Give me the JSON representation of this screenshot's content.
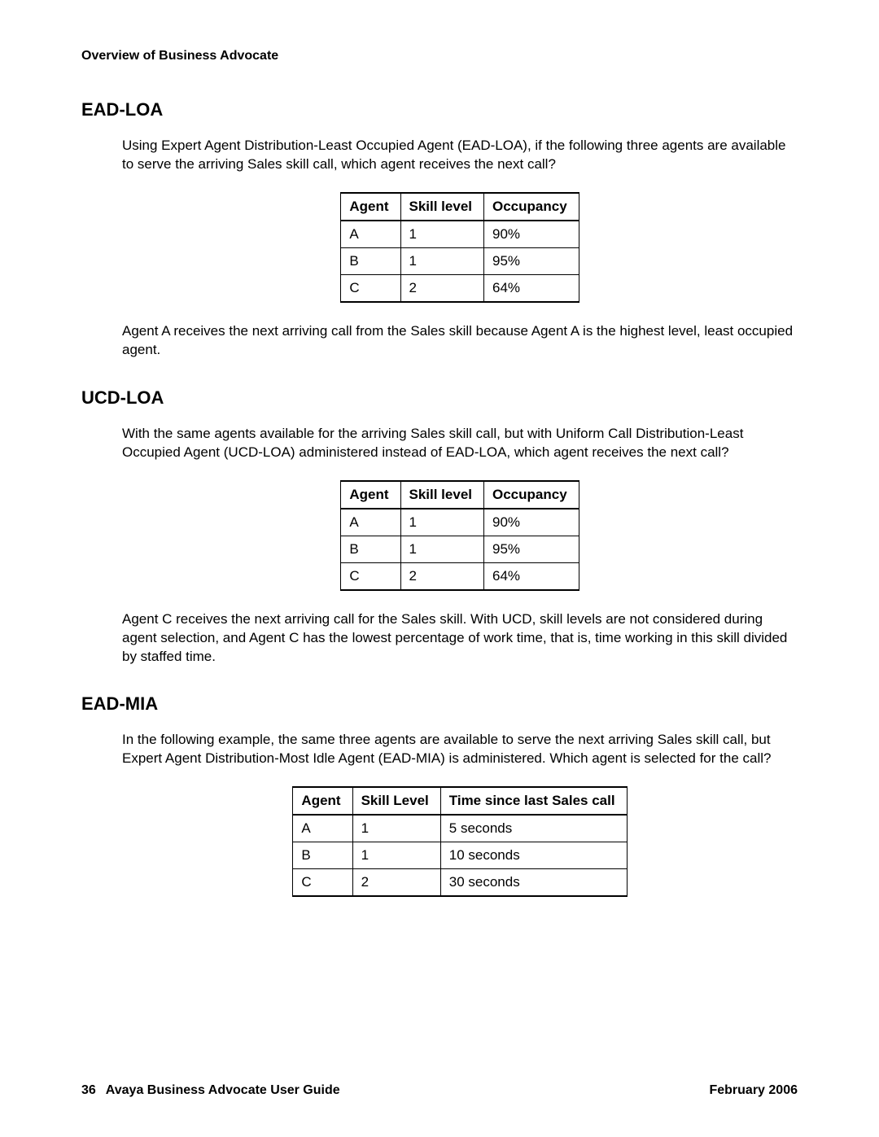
{
  "header": {
    "running_title": "Overview of Business Advocate"
  },
  "sections": [
    {
      "id": "ead-loa",
      "title": "EAD-LOA",
      "intro": "Using Expert Agent Distribution-Least Occupied Agent (EAD-LOA), if the following three agents are available to serve the arriving Sales skill call, which agent receives the next call?",
      "table": {
        "headers": [
          "Agent",
          "Skill level",
          "Occupancy"
        ],
        "rows": [
          [
            "A",
            "1",
            "90%"
          ],
          [
            "B",
            "1",
            "95%"
          ],
          [
            "C",
            "2",
            "64%"
          ]
        ]
      },
      "conclusion": "Agent A receives the next arriving call from the Sales skill because Agent A is the highest level, least occupied agent."
    },
    {
      "id": "ucd-loa",
      "title": "UCD-LOA",
      "intro": "With the same agents available for the arriving Sales skill call, but with Uniform Call Distribution-Least Occupied Agent (UCD-LOA) administered instead of EAD-LOA, which agent receives the next call?",
      "table": {
        "headers": [
          "Agent",
          "Skill level",
          "Occupancy"
        ],
        "rows": [
          [
            "A",
            "1",
            "90%"
          ],
          [
            "B",
            "1",
            "95%"
          ],
          [
            "C",
            "2",
            "64%"
          ]
        ]
      },
      "conclusion": "Agent C receives the next arriving call for the Sales skill. With UCD, skill levels are not considered during agent selection, and Agent C has the lowest percentage of work time, that is, time working in this skill divided by staffed time."
    },
    {
      "id": "ead-mia",
      "title": "EAD-MIA",
      "intro": "In the following example, the same three agents are available to serve the next arriving Sales skill call, but Expert Agent Distribution-Most Idle Agent (EAD-MIA) is administered. Which agent is selected for the call?",
      "table": {
        "headers": [
          "Agent",
          "Skill Level",
          "Time since last Sales call"
        ],
        "rows": [
          [
            "A",
            "1",
            "5 seconds"
          ],
          [
            "B",
            "1",
            "10 seconds"
          ],
          [
            "C",
            "2",
            "30 seconds"
          ]
        ]
      },
      "conclusion": ""
    }
  ],
  "footer": {
    "page_number": "36",
    "guide_title": "Avaya Business Advocate User Guide",
    "date": "February 2006"
  }
}
